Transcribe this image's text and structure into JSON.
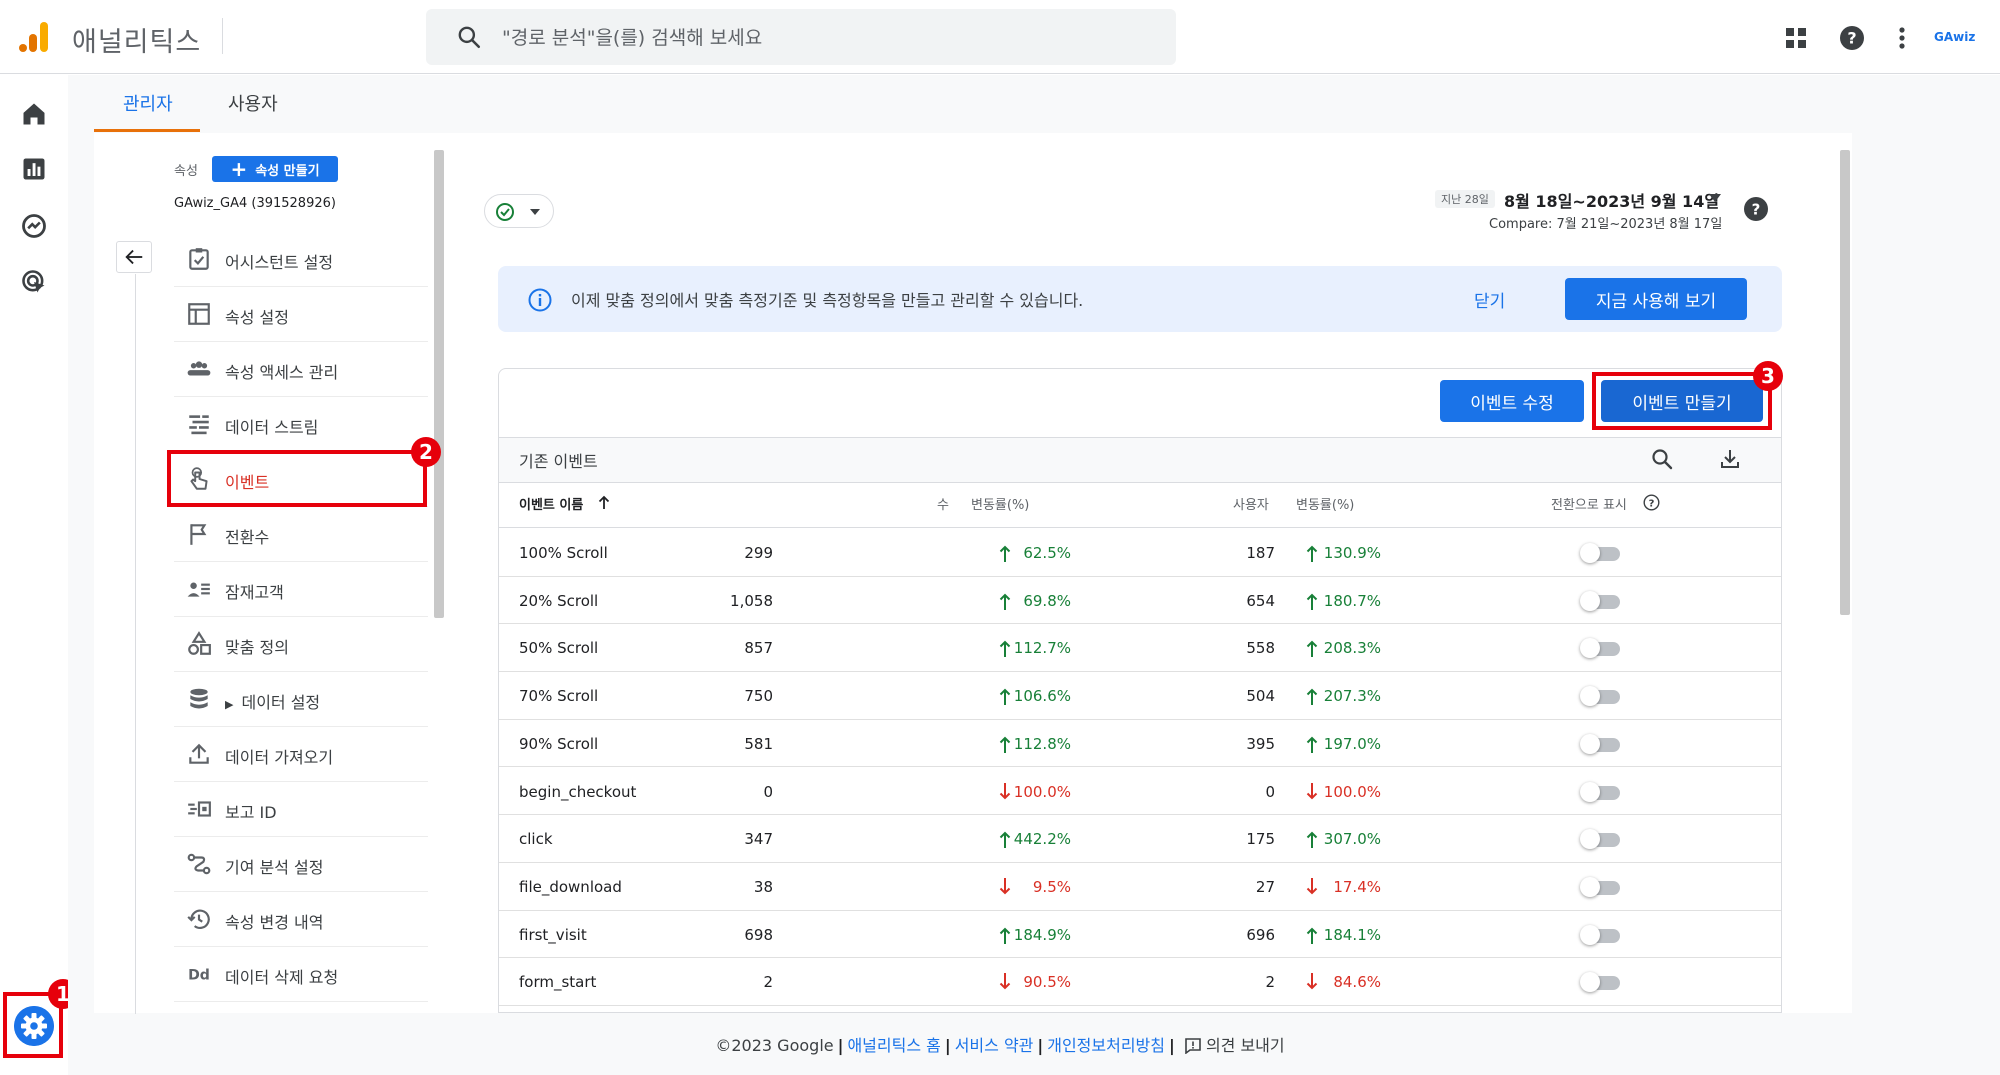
{
  "app": {
    "title": "애널리틱스",
    "account_label": "GAwiz"
  },
  "search": {
    "placeholder": "\"경로 분석\"을(를) 검색해 보세요"
  },
  "tabs": [
    {
      "label": "관리자"
    },
    {
      "label": "사용자"
    }
  ],
  "property": {
    "label": "속성",
    "create_label": "속성 만들기",
    "name": "GAwiz_GA4 (391528926)"
  },
  "nav": {
    "items": [
      {
        "label": "어시스턴트 설정",
        "icon": "checklist-icon"
      },
      {
        "label": "속성 설정",
        "icon": "window-icon"
      },
      {
        "label": "속성 액세스 관리",
        "icon": "people-icon"
      },
      {
        "label": "데이터 스트림",
        "icon": "streams-icon"
      },
      {
        "label": "이벤트",
        "icon": "touch-icon"
      },
      {
        "label": "전환수",
        "icon": "flag-icon"
      },
      {
        "label": "잠재고객",
        "icon": "audience-icon"
      },
      {
        "label": "맞춤 정의",
        "icon": "shapes-icon"
      },
      {
        "label": "데이터 설정",
        "icon": "database-icon"
      },
      {
        "label": "데이터 가져오기",
        "icon": "upload-icon"
      },
      {
        "label": "보고 ID",
        "icon": "reporting-id-icon"
      },
      {
        "label": "기여 분석 설정",
        "icon": "attribution-icon"
      },
      {
        "label": "속성 변경 내역",
        "icon": "history-icon"
      },
      {
        "label": "데이터 삭제 요청",
        "icon": "dd-icon"
      }
    ]
  },
  "annotations": [
    "1",
    "2",
    "3"
  ],
  "date": {
    "period": "지난 28일",
    "range": "8월 18일~2023년 9월 14일",
    "compare": "Compare: 7월 21일~2023년 8월 17일"
  },
  "banner": {
    "text": "이제 맞춤 정의에서 맞춤 측정기준 및 측정항목을 만들고 관리할 수 있습니다.",
    "close_label": "닫기",
    "action_label": "지금 사용해 보기"
  },
  "events": {
    "modify_label": "이벤트 수정",
    "create_label": "이벤트 만들기",
    "section_title": "기존 이벤트",
    "columns": {
      "name": "이벤트 이름",
      "count": "수",
      "count_change": "변동률(%)",
      "users": "사용자",
      "users_change": "변동률(%)",
      "conversion": "전환으로 표시"
    },
    "rows": [
      {
        "name": "100% Scroll",
        "count": "299",
        "count_dir": "up",
        "count_pct": "62.5%",
        "users": "187",
        "users_dir": "up",
        "users_pct": "130.9%"
      },
      {
        "name": "20% Scroll",
        "count": "1,058",
        "count_dir": "up",
        "count_pct": "69.8%",
        "users": "654",
        "users_dir": "up",
        "users_pct": "180.7%"
      },
      {
        "name": "50% Scroll",
        "count": "857",
        "count_dir": "up",
        "count_pct": "112.7%",
        "users": "558",
        "users_dir": "up",
        "users_pct": "208.3%"
      },
      {
        "name": "70% Scroll",
        "count": "750",
        "count_dir": "up",
        "count_pct": "106.6%",
        "users": "504",
        "users_dir": "up",
        "users_pct": "207.3%"
      },
      {
        "name": "90% Scroll",
        "count": "581",
        "count_dir": "up",
        "count_pct": "112.8%",
        "users": "395",
        "users_dir": "up",
        "users_pct": "197.0%"
      },
      {
        "name": "begin_checkout",
        "count": "0",
        "count_dir": "down",
        "count_pct": "100.0%",
        "users": "0",
        "users_dir": "down",
        "users_pct": "100.0%"
      },
      {
        "name": "click",
        "count": "347",
        "count_dir": "up",
        "count_pct": "442.2%",
        "users": "175",
        "users_dir": "up",
        "users_pct": "307.0%"
      },
      {
        "name": "file_download",
        "count": "38",
        "count_dir": "down",
        "count_pct": "9.5%",
        "users": "27",
        "users_dir": "down",
        "users_pct": "17.4%"
      },
      {
        "name": "first_visit",
        "count": "698",
        "count_dir": "up",
        "count_pct": "184.9%",
        "users": "696",
        "users_dir": "up",
        "users_pct": "184.1%"
      },
      {
        "name": "form_start",
        "count": "2",
        "count_dir": "down",
        "count_pct": "90.5%",
        "users": "2",
        "users_dir": "down",
        "users_pct": "84.6%"
      }
    ]
  },
  "footer": {
    "copyright": "©2023 Google",
    "links": [
      "애널리틱스 홈",
      "서비스 약관",
      "개인정보처리방침"
    ],
    "feedback": "의견 보내기"
  },
  "colors": {
    "accent": "#1a73e8",
    "up": "#188038",
    "down": "#d93025",
    "annotation": "#e6000b",
    "tab_underline": "#e8710a"
  }
}
